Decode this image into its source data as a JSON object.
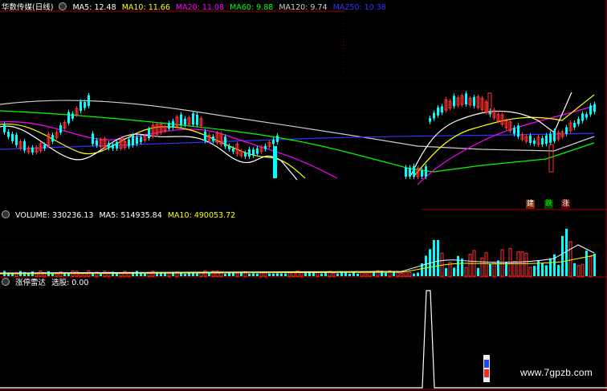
{
  "header_main": {
    "stock": "华数传媒(日线)",
    "ma": [
      {
        "label": "MA5: 12.48",
        "color": "#ffffff"
      },
      {
        "label": "MA10: 11.66",
        "color": "#ffff00"
      },
      {
        "label": "MA20: 11.08",
        "color": "#ff00ff"
      },
      {
        "label": "MA60: 9.88",
        "color": "#00ff00"
      },
      {
        "label": "MA120: 9.74",
        "color": "#cccccc"
      },
      {
        "label": "MA250: 10.38",
        "color": "#3333ff"
      }
    ]
  },
  "header_volume": {
    "volume": {
      "label": "VOLUME: 330236.13",
      "color": "#ffffff"
    },
    "ma5": {
      "label": "MA5: 514935.84",
      "color": "#ffffff"
    },
    "ma10": {
      "label": "MA10: 490053.72",
      "color": "#ffff00"
    }
  },
  "header_indicator": {
    "name": "涨停雷达",
    "value": "选股: 0.00"
  },
  "badges": {
    "b1": {
      "text": "建",
      "color": "#ff3333"
    },
    "b2": {
      "text": "跌",
      "color": "#00cc00"
    },
    "b3": {
      "text": "涨",
      "color": "#ff3333"
    }
  },
  "watermark": "www.7gpzb.com",
  "colors": {
    "up": "#ff3333",
    "down": "#00ffff",
    "grid": "#7a0000",
    "ma5": "#ffffff",
    "ma10": "#ffff00",
    "ma20": "#ff00ff",
    "ma60": "#00ff00",
    "ma120": "#cccccc",
    "ma250": "#3333ff"
  },
  "chart_data": {
    "type": "candlestick",
    "series": [
      {
        "name": "MA5",
        "color": "#ffffff"
      },
      {
        "name": "MA10",
        "color": "#ffff00"
      },
      {
        "name": "MA20",
        "color": "#ff00ff"
      },
      {
        "name": "MA60",
        "color": "#00ff00"
      },
      {
        "name": "MA120",
        "color": "#cccccc"
      },
      {
        "name": "MA250",
        "color": "#3333ff"
      },
      {
        "name": "VOLUME",
        "color": "#ffffff"
      },
      {
        "name": "选股",
        "values": [
          0,
          0,
          1,
          0
        ],
        "color": "#ffffff"
      }
    ]
  }
}
